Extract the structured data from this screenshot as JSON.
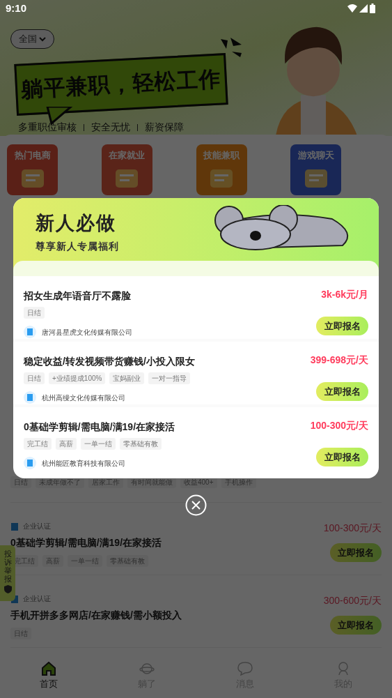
{
  "status_bar": {
    "time": "9:10"
  },
  "header": {
    "region": "全国",
    "slogan": "躺平兼职，轻松工作",
    "features": [
      "多重职位审核",
      "安全无忧",
      "薪资保障"
    ]
  },
  "categories": [
    {
      "label": "热门电商"
    },
    {
      "label": "在家就业"
    },
    {
      "label": "技能兼职"
    },
    {
      "label": "游戏聊天"
    }
  ],
  "job_list": [
    {
      "kind": "partial",
      "tags": [
        "日结",
        "未成年做不了",
        "居家工作",
        "有时间就能做",
        "收益400+",
        "手机操作"
      ]
    },
    {
      "kind": "full",
      "verified_label": "企业认证",
      "title": "0基础学剪辑/需电脑/满19/在家接活",
      "salary": "100-300元/天",
      "tags": [
        "完工结",
        "高薪",
        "一单一结",
        "零基础有教"
      ],
      "button": "立即报名"
    },
    {
      "kind": "full",
      "verified_label": "企业认证",
      "title": "手机开拼多多网店/在家赚钱/需小额投入",
      "salary": "300-600元/天",
      "tags": [
        "日结"
      ],
      "button": "立即报名"
    }
  ],
  "report_tab": {
    "label": "投诉举报"
  },
  "bottom_nav": [
    {
      "label": "首页",
      "selected": true
    },
    {
      "label": "躺了",
      "selected": false
    },
    {
      "label": "消息",
      "selected": false
    },
    {
      "label": "我的",
      "selected": false
    }
  ],
  "popup": {
    "title": "新人必做",
    "subtitle": "尊享新人专属福利",
    "jobs": [
      {
        "title": "招女生成年语音厅不露脸",
        "salary": "3k-6k元/月",
        "tags": [
          "日结"
        ],
        "company": "唐河县星虎文化传媒有限公司",
        "button": "立即报名"
      },
      {
        "title": "稳定收益/转发视频带货赚钱/小投入限女",
        "salary": "399-698元/天",
        "tags": [
          "日结",
          "+业绩提成100%",
          "宝妈副业",
          "一对一指导"
        ],
        "company": "杭州高缦文化传媒有限公司",
        "button": "立即报名"
      },
      {
        "title": "0基础学剪辑/需电脑/满19/在家接活",
        "salary": "100-300元/天",
        "tags": [
          "完工结",
          "高薪",
          "一单一结",
          "零基础有教"
        ],
        "company": "杭州能匠教育科技有限公司",
        "button": "立即报名"
      }
    ]
  }
}
